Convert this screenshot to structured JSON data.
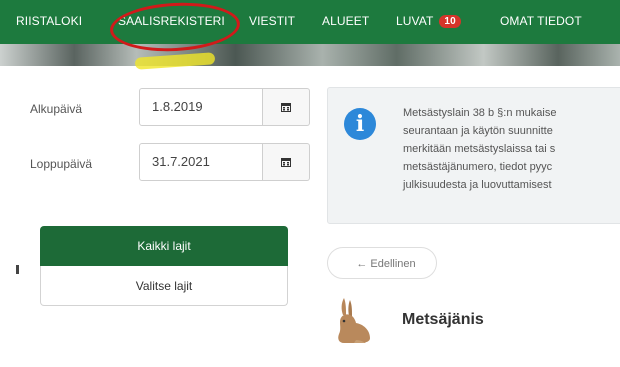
{
  "nav": {
    "items": [
      {
        "label": "RIISTALOKI"
      },
      {
        "label": "SAALISREKISTERI"
      },
      {
        "label": "VIESTIT"
      },
      {
        "label": "ALUEET"
      },
      {
        "label": "LUVAT",
        "badge": "10"
      },
      {
        "label": "OMAT TIEDOT"
      }
    ]
  },
  "form": {
    "start_label": "Alkupäivä",
    "start_value": "1.8.2019",
    "end_label": "Loppupäivä",
    "end_value": "31.7.2021"
  },
  "info": {
    "lines": [
      "Metsästyslain 38 b §:n mukaise",
      "seurantaan ja käytön suunnitte",
      "merkitään metsästyslaissa tai s",
      "metsästäjänumero, tiedot pyyc",
      "julkisuudesta ja luovuttamisest"
    ]
  },
  "buttons": {
    "all_species": "Kaikki lajit",
    "choose_species": "Valitse lajit",
    "previous": "← Edellinen"
  },
  "species": {
    "name": "Metsäjänis"
  },
  "colors": {
    "nav_bg": "#1d7a3e",
    "primary_button": "#1d6a37",
    "badge": "#d6342a",
    "info_icon": "#2d88d9",
    "annotation_circle": "#d11a1a"
  }
}
